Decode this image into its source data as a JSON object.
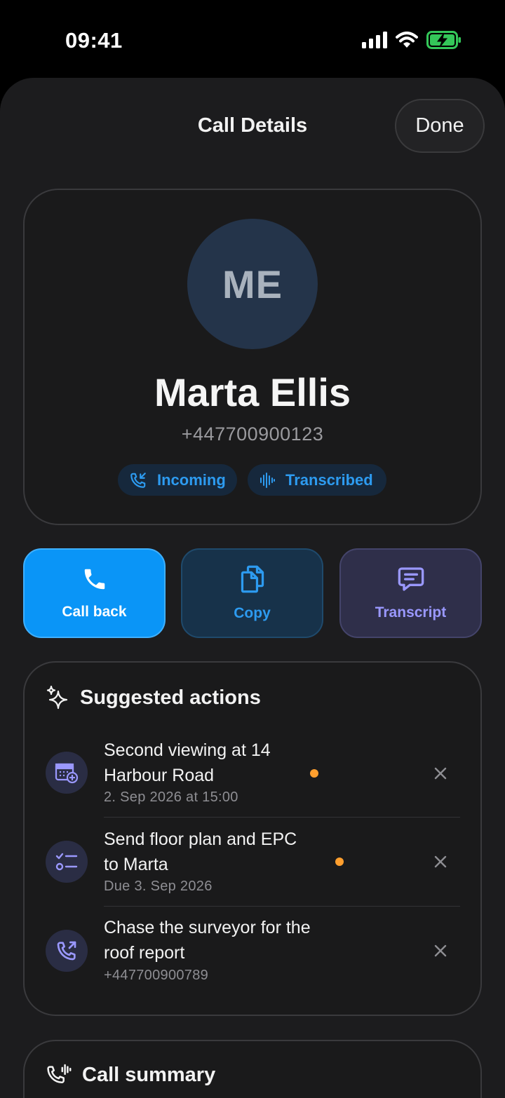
{
  "status_bar": {
    "time": "09:41"
  },
  "header": {
    "title": "Call Details",
    "done_label": "Done"
  },
  "contact": {
    "initials": "ME",
    "name": "Marta Ellis",
    "phone": "+447700900123",
    "badges": [
      {
        "label": "Incoming",
        "icon": "incoming-call-icon"
      },
      {
        "label": "Transcribed",
        "icon": "waveform-icon"
      }
    ]
  },
  "actions": [
    {
      "label": "Call back",
      "icon": "phone-icon"
    },
    {
      "label": "Copy",
      "icon": "copy-icon"
    },
    {
      "label": "Transcript",
      "icon": "chat-bubble-icon"
    }
  ],
  "suggested": {
    "title": "Suggested actions",
    "items": [
      {
        "line1": "Second viewing at 14",
        "line2": "Harbour Road",
        "sub": "2. Sep 2026 at 15:00",
        "icon": "calendar-add-icon",
        "unread": true
      },
      {
        "line1": "Send floor plan and EPC",
        "line2": "to Marta",
        "sub": "Due 3. Sep 2026",
        "icon": "checklist-icon",
        "unread": true
      },
      {
        "line1": "Chase the surveyor for the",
        "line2": "roof report",
        "sub": "+447700900789",
        "icon": "outgoing-call-icon",
        "unread": false
      }
    ]
  },
  "summary": {
    "title": "Call summary"
  },
  "colors": {
    "accent": "#0a95f7",
    "link": "#2d9bf0",
    "transcript": "#9a98ff",
    "dot": "#ff9f2e"
  }
}
